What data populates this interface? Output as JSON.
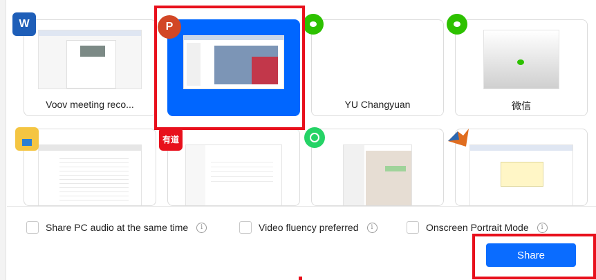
{
  "windows": [
    {
      "label": "Voov meeting reco...",
      "app_icon": "word-icon",
      "selected": false
    },
    {
      "label": "",
      "app_icon": "powerpoint-icon",
      "selected": true
    },
    {
      "label": "YU Changyuan",
      "app_icon": "wechat-icon",
      "selected": false
    },
    {
      "label": "微信",
      "app_icon": "wechat-icon",
      "selected": false
    },
    {
      "label": "",
      "app_icon": "file-explorer-icon",
      "selected": false
    },
    {
      "label": "",
      "app_icon": "youdao-icon",
      "selected": false
    },
    {
      "label": "",
      "app_icon": "whatsapp-icon",
      "selected": false
    },
    {
      "label": "",
      "app_icon": "matlab-icon",
      "selected": false
    }
  ],
  "icons": {
    "word": "W",
    "powerpoint": "P",
    "youdao": "有道"
  },
  "options": {
    "share_audio": "Share PC audio at the same time",
    "video_fluency": "Video fluency preferred",
    "portrait_mode": "Onscreen Portrait Mode",
    "info_glyph": "i"
  },
  "share_button": "Share",
  "colors": {
    "selected": "#0066ff",
    "share_button": "#0a6cff",
    "highlight": "#e8101c"
  }
}
